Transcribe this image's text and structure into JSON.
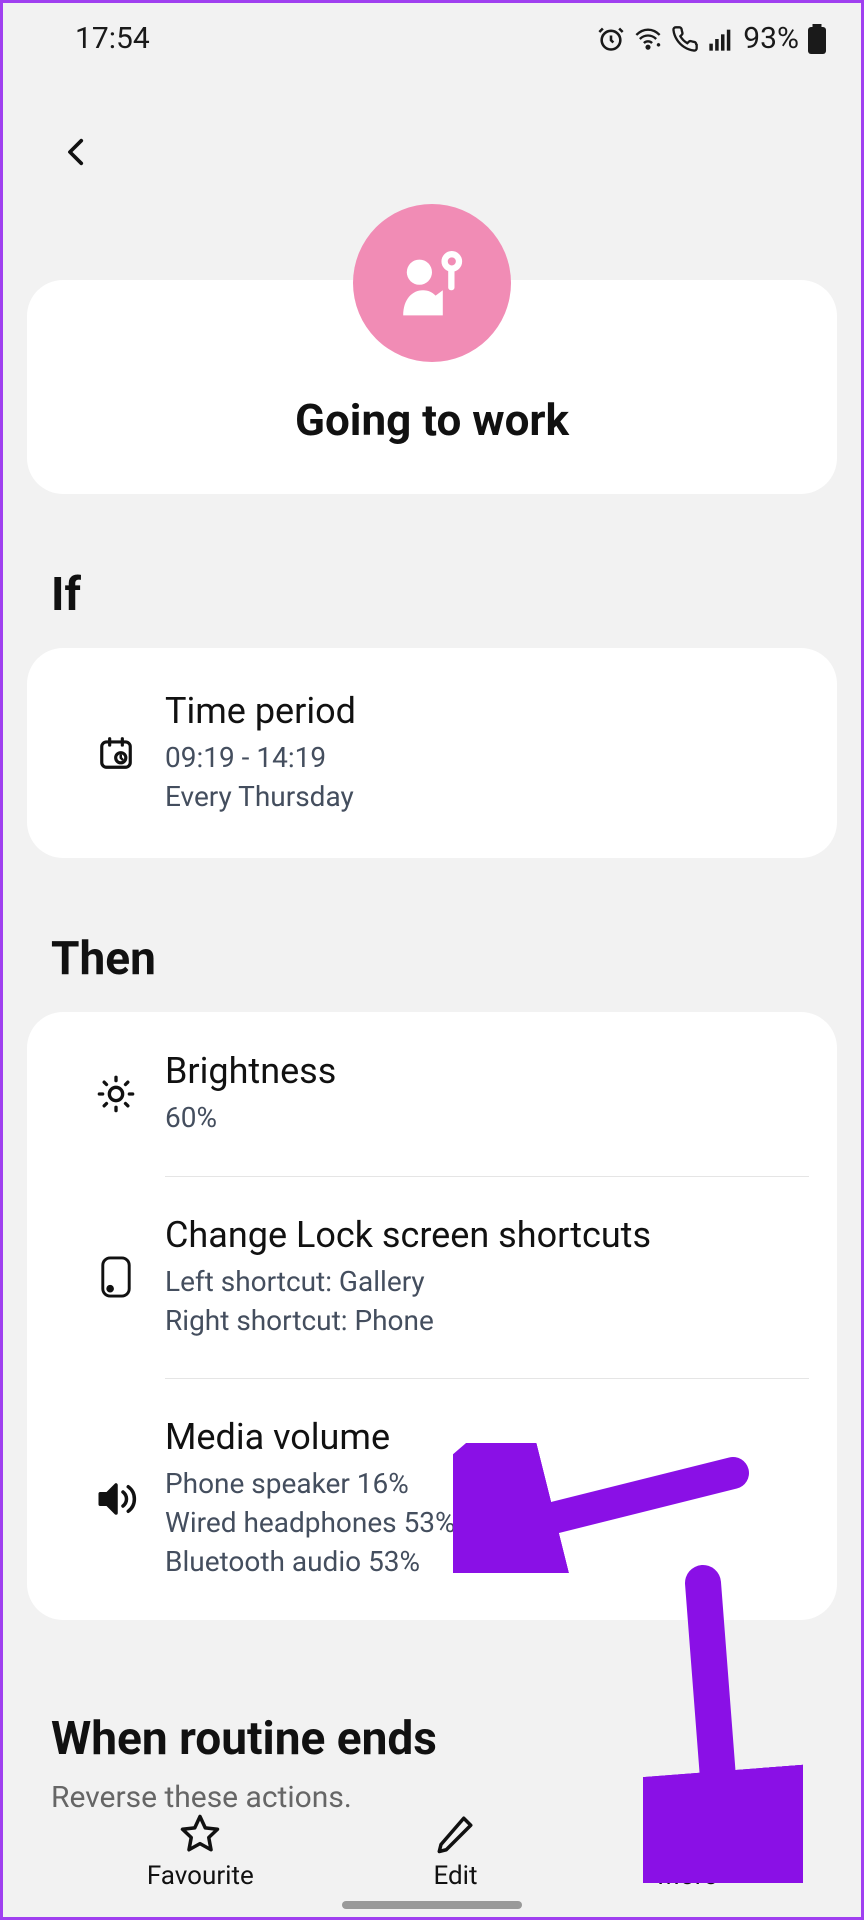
{
  "status": {
    "time": "17:54",
    "battery": "93%"
  },
  "routine": {
    "title": "Going to work"
  },
  "sections": {
    "if": "If",
    "then": "Then",
    "ends": "When routine ends",
    "ends_sub": "Reverse these actions."
  },
  "if_items": [
    {
      "title": "Time period",
      "sub1": "09:19 - 14:19",
      "sub2": "Every Thursday"
    }
  ],
  "then_items": [
    {
      "title": "Brightness",
      "sub1": "60%",
      "sub2": ""
    },
    {
      "title": "Change Lock screen shortcuts",
      "sub1": "Left shortcut: Gallery",
      "sub2": "Right shortcut: Phone"
    },
    {
      "title": "Media volume",
      "sub1": "Phone speaker 16%",
      "sub2": "Wired headphones 53%",
      "sub3": "Bluetooth audio 53%"
    }
  ],
  "bottom": {
    "favourite": "Favourite",
    "edit": "Edit",
    "more": "More"
  }
}
